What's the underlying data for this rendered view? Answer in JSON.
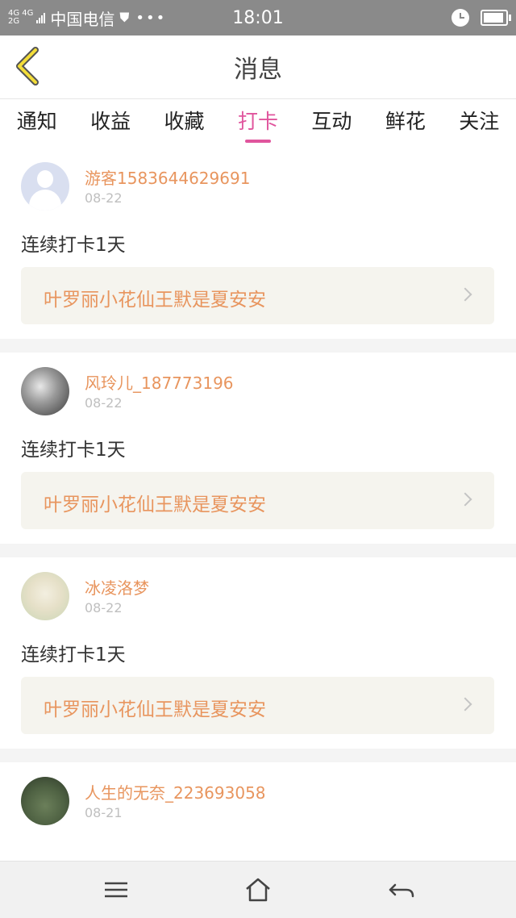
{
  "status_bar": {
    "network_top": "4G 4G",
    "network_bottom": "2G",
    "carrier": "中国电信",
    "dots": "•••",
    "time": "18:01"
  },
  "header": {
    "title": "消息"
  },
  "tabs": [
    {
      "label": "通知",
      "active": false
    },
    {
      "label": "收益",
      "active": false
    },
    {
      "label": "收藏",
      "active": false
    },
    {
      "label": "打卡",
      "active": true
    },
    {
      "label": "互动",
      "active": false
    },
    {
      "label": "鲜花",
      "active": false
    },
    {
      "label": "关注",
      "active": false
    }
  ],
  "accent_color": "#e0559d",
  "name_color": "#e8955e",
  "messages": [
    {
      "user": "游客1583644629691",
      "date": "08-22",
      "text": "连续打卡1天",
      "link": "叶罗丽小花仙王默是夏安安"
    },
    {
      "user": "风玲儿_187773196",
      "date": "08-22",
      "text": "连续打卡1天",
      "link": "叶罗丽小花仙王默是夏安安"
    },
    {
      "user": "冰凌洛梦",
      "date": "08-22",
      "text": "连续打卡1天",
      "link": "叶罗丽小花仙王默是夏安安"
    },
    {
      "user": "人生的无奈_223693058",
      "date": "08-21"
    }
  ]
}
